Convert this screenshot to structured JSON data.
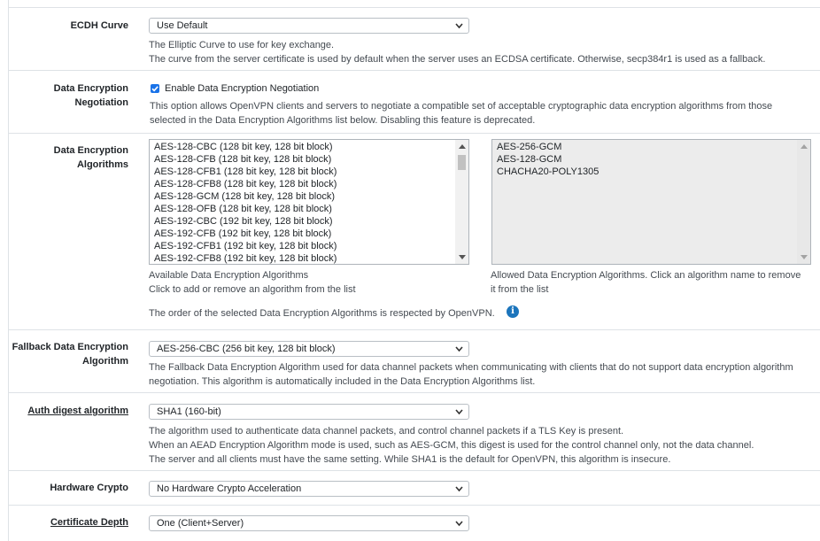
{
  "ecdh": {
    "label": "ECDH Curve",
    "value": "Use Default",
    "help1": "The Elliptic Curve to use for key exchange.",
    "help2": "The curve from the server certificate is used by default when the server uses an ECDSA certificate. Otherwise, secp384r1 is used as a fallback."
  },
  "negotiation": {
    "label_line1": "Data Encryption",
    "label_line2": "Negotiation",
    "checkbox_label": "Enable Data Encryption Negotiation",
    "checked": true,
    "help1": "This option allows OpenVPN clients and servers to negotiate a compatible set of acceptable cryptographic data encryption algorithms from those",
    "help2": "selected in the Data Encryption Algorithms list below. Disabling this feature is deprecated."
  },
  "algorithms": {
    "label_line1": "Data Encryption",
    "label_line2": "Algorithms",
    "available": [
      "AES-128-CBC (128 bit key, 128 bit block)",
      "AES-128-CFB (128 bit key, 128 bit block)",
      "AES-128-CFB1 (128 bit key, 128 bit block)",
      "AES-128-CFB8 (128 bit key, 128 bit block)",
      "AES-128-GCM (128 bit key, 128 bit block)",
      "AES-128-OFB (128 bit key, 128 bit block)",
      "AES-192-CBC (192 bit key, 128 bit block)",
      "AES-192-CFB (192 bit key, 128 bit block)",
      "AES-192-CFB1 (192 bit key, 128 bit block)",
      "AES-192-CFB8 (192 bit key, 128 bit block)"
    ],
    "allowed": [
      "AES-256-GCM",
      "AES-128-GCM",
      "CHACHA20-POLY1305"
    ],
    "available_help1": "Available Data Encryption Algorithms",
    "available_help2": "Click to add or remove an algorithm from the list",
    "allowed_help1": "Allowed Data Encryption Algorithms. Click an algorithm name to remove",
    "allowed_help2": "it from the list",
    "order_note": "The order of the selected Data Encryption Algorithms is respected by OpenVPN."
  },
  "fallback": {
    "label_line1": "Fallback Data Encryption",
    "label_line2": "Algorithm",
    "value": "AES-256-CBC (256 bit key, 128 bit block)",
    "help1": "The Fallback Data Encryption Algorithm used for data channel packets when communicating with clients that do not support data encryption algorithm",
    "help2": "negotiation. This algorithm is automatically included in the Data Encryption Algorithms list."
  },
  "auth_digest": {
    "label": "Auth digest algorithm",
    "value": "SHA1 (160-bit)",
    "help1": "The algorithm used to authenticate data channel packets, and control channel packets if a TLS Key is present.",
    "help2": "When an AEAD Encryption Algorithm mode is used, such as AES-GCM, this digest is used for the control channel only, not the data channel.",
    "help3": "The server and all clients must have the same setting. While SHA1 is the default for OpenVPN, this algorithm is insecure."
  },
  "hardware_crypto": {
    "label": "Hardware Crypto",
    "value": "No Hardware Crypto Acceleration"
  },
  "cert_depth": {
    "label": "Certificate Depth",
    "value": "One (Client+Server)"
  },
  "icons": {
    "select_arrow": "chevron-down-icon",
    "info": "info-icon",
    "check": "checkmark-icon"
  },
  "colors": {
    "checkbox": "#1a73e8",
    "info": "#1c75bc"
  }
}
